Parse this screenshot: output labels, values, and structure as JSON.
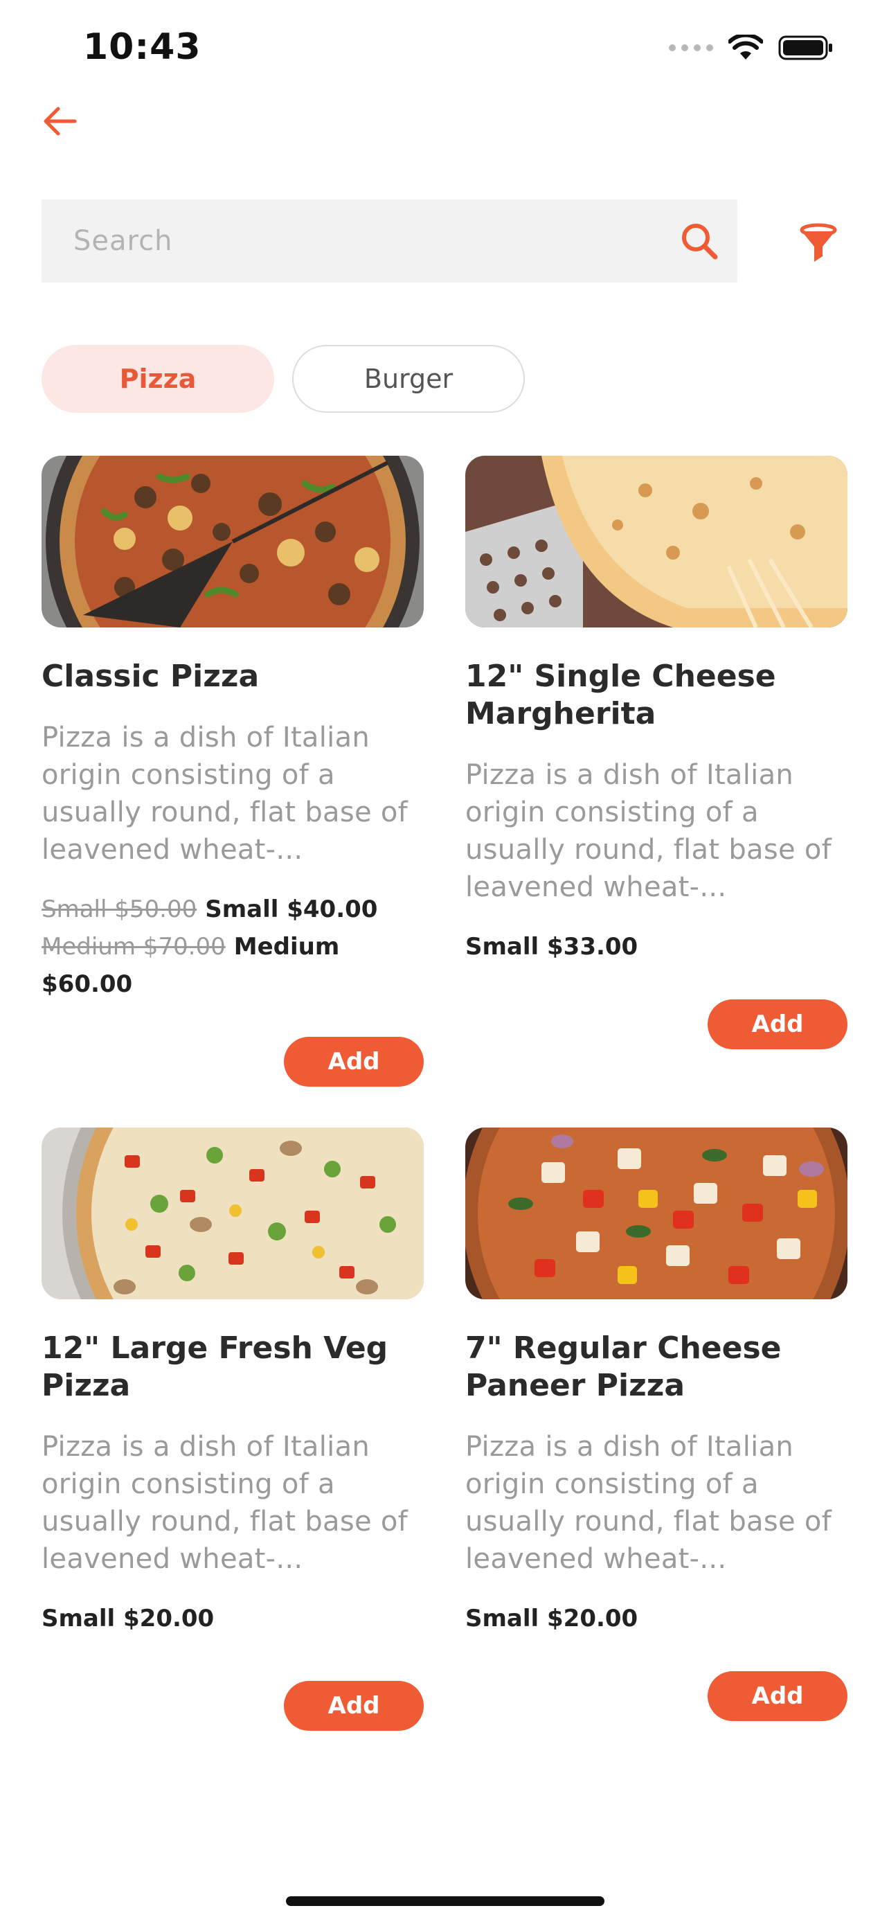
{
  "status": {
    "time": "10:43"
  },
  "search": {
    "placeholder": "Search"
  },
  "chips": [
    {
      "label": "Pizza",
      "active": true
    },
    {
      "label": "Burger",
      "active": false
    }
  ],
  "colors": {
    "accent": "#ef5b35",
    "chip_active_bg": "#fde7e5",
    "muted_text": "#9a9a9a"
  },
  "products": [
    {
      "title": "Classic Pizza",
      "description": "Pizza is a dish of Italian origin consisting of a usually round, flat base of leavened wheat-...",
      "price_line_1_old": "Small $50.00",
      "price_line_1_new": "Small $40.00",
      "price_line_2_old": "Medium $70.00",
      "price_line_2_new": "Medium $60.00",
      "add_label": "Add"
    },
    {
      "title": "12\" Single Cheese Margherita",
      "description": "Pizza is a dish of Italian origin consisting of a usually round, flat base of leavened wheat-...",
      "price": "Small $33.00",
      "add_label": "Add"
    },
    {
      "title": "12\" Large Fresh Veg Pizza",
      "description": "Pizza is a dish of Italian origin consisting of a usually round, flat base of leavened wheat-...",
      "price": "Small $20.00",
      "add_label": "Add"
    },
    {
      "title": "7\" Regular Cheese Paneer Pizza",
      "description": "Pizza is a dish of Italian origin consisting of a usually round, flat base of leavened wheat-...",
      "price": "Small $20.00",
      "add_label": "Add"
    }
  ]
}
